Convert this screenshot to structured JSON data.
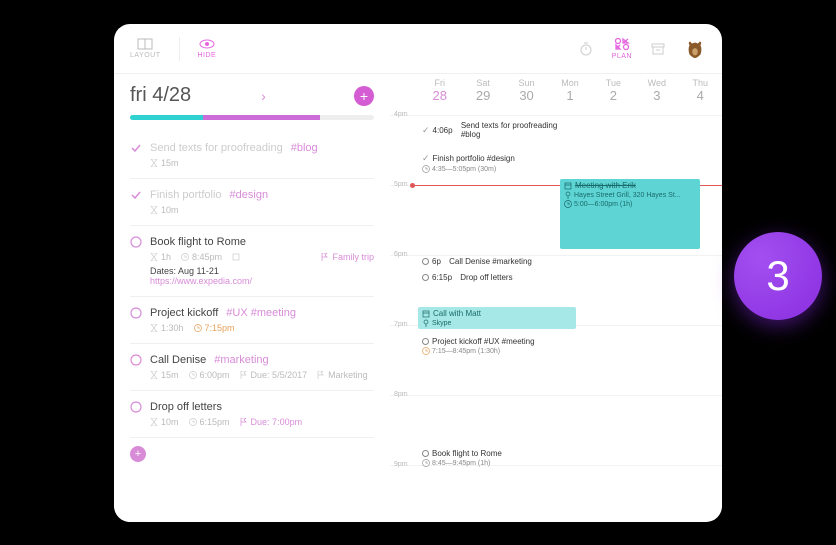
{
  "topbar": {
    "layout": "LAYOUT",
    "hide": "HIDE",
    "plan": "PLAN"
  },
  "date_title": "fri 4/28",
  "tasks": [
    {
      "done": true,
      "title": "Send texts for proofreading",
      "tag": "#blog",
      "duration": "15m"
    },
    {
      "done": true,
      "title": "Finish portfolio",
      "tag": "#design",
      "duration": "10m"
    },
    {
      "done": false,
      "title": "Book flight to Rome",
      "duration": "1h",
      "time": "8:45pm",
      "flag": "Family trip",
      "notes1": "Dates: Aug 11-21",
      "notes2": "https://www.expedia.com/"
    },
    {
      "done": false,
      "title": "Project kickoff",
      "tag": "#UX #meeting",
      "duration": "1:30h",
      "time": "7:15pm"
    },
    {
      "done": false,
      "title": "Call Denise",
      "tag": "#marketing",
      "duration": "15m",
      "time": "6:00pm",
      "due": "Due: 5/5/2017",
      "flag": "Marketing"
    },
    {
      "done": false,
      "title": "Drop off letters",
      "duration": "10m",
      "time": "6:15pm",
      "due": "Due: 7:00pm"
    }
  ],
  "week": [
    {
      "label": "Fri",
      "num": "28",
      "today": true
    },
    {
      "label": "Sat",
      "num": "29"
    },
    {
      "label": "Sun",
      "num": "30"
    },
    {
      "label": "Mon",
      "num": "1"
    },
    {
      "label": "Tue",
      "num": "2"
    },
    {
      "label": "Wed",
      "num": "3"
    },
    {
      "label": "Thu",
      "num": "4"
    }
  ],
  "hours": [
    "4pm",
    "5pm",
    "6pm",
    "7pm",
    "8pm",
    "9pm"
  ],
  "events": {
    "e1": {
      "time": "4:06p",
      "title": "Send texts for proofreading #blog"
    },
    "e2": {
      "title": "Finish portfolio #design",
      "sub": "4:35—5:05pm  (30m)"
    },
    "e3": {
      "title": "Meeting with Erik",
      "sub1": "Hayes Street Grill, 320 Hayes St...",
      "sub2": "5:00—6:00pm  (1h)"
    },
    "e4": {
      "time": "6p",
      "title": "Call Denise #marketing"
    },
    "e5": {
      "time": "6:15p",
      "title": "Drop off letters"
    },
    "e6": {
      "title": "Call with Matt",
      "sub": "Skype"
    },
    "e7": {
      "title": "Project kickoff #UX #meeting",
      "sub": "7:15—8:45pm  (1:30h)"
    },
    "e8": {
      "title": "Book flight to Rome",
      "sub": "8:45—9:45pm  (1h)"
    }
  },
  "badge": "3"
}
